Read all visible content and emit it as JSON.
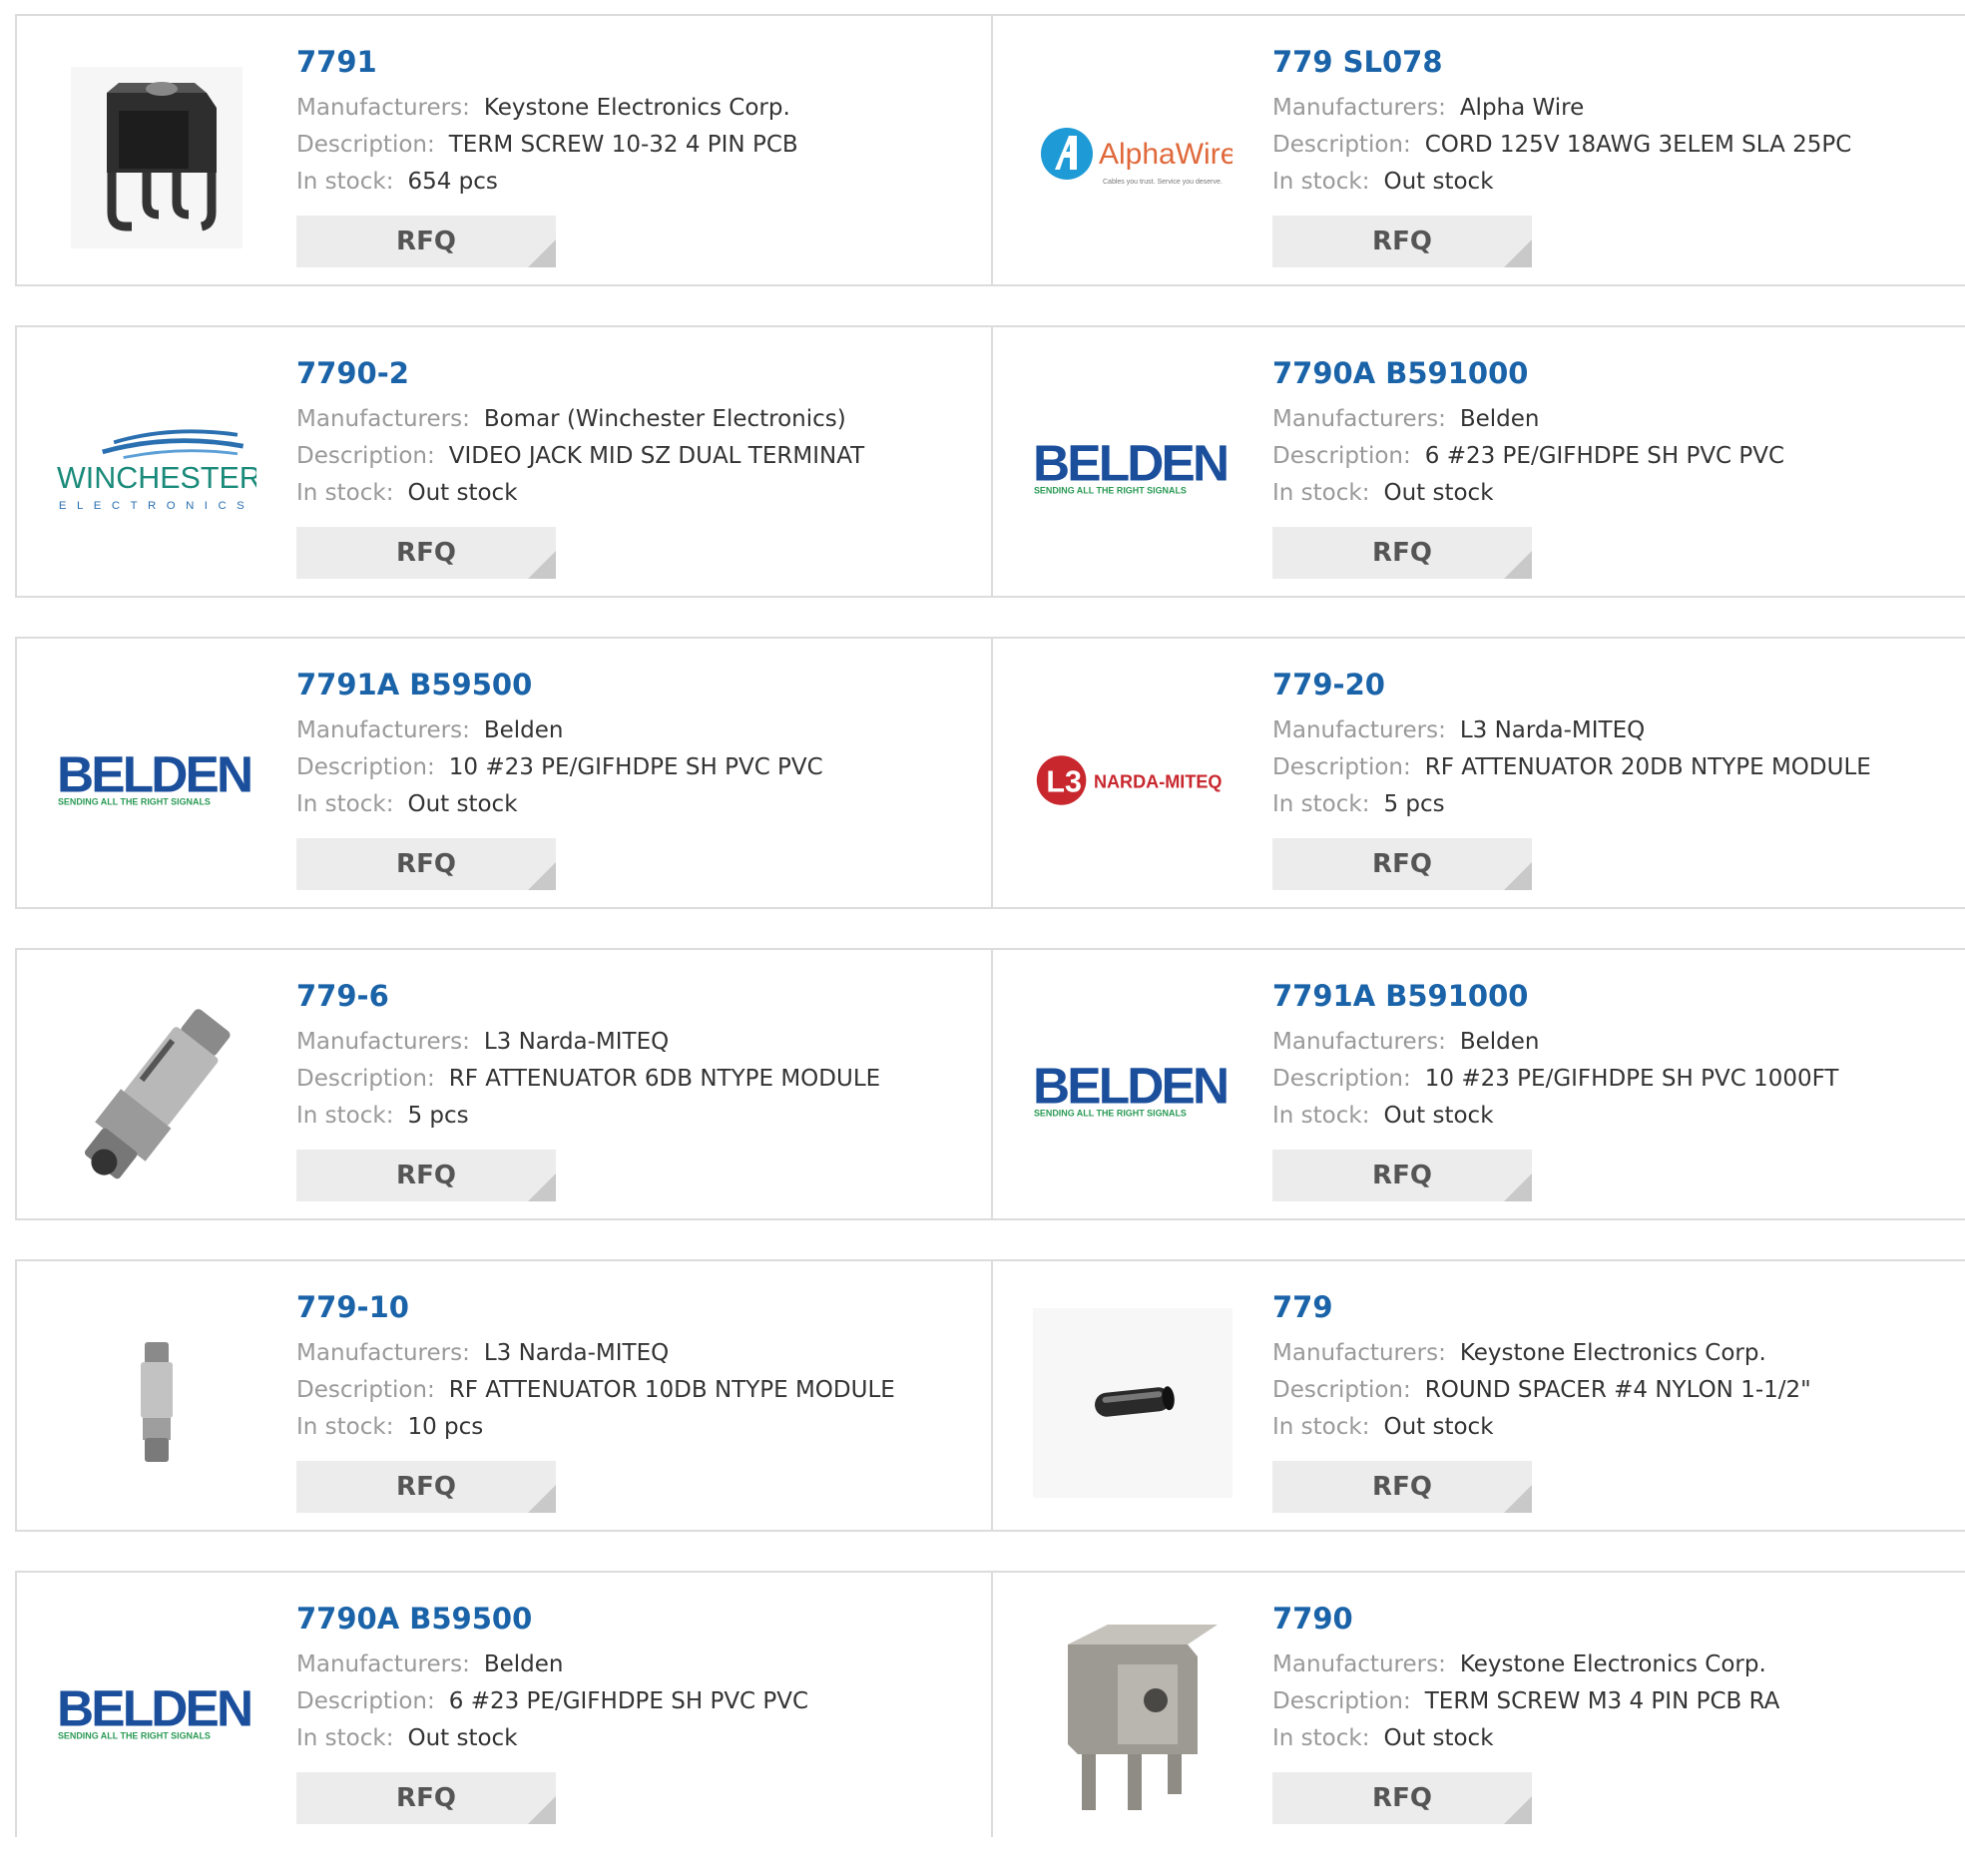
{
  "labels": {
    "manufacturers": "Manufacturers:",
    "description": "Description:",
    "in_stock": "In stock:",
    "rfq": "RFQ"
  },
  "colors": {
    "link_blue": "#1a63a8",
    "label_gray": "#999999",
    "value_dark": "#333333",
    "rfq_bg": "#ececec",
    "border": "#dcdcdc"
  },
  "logos": {
    "alphawire_name": "AlphaWire",
    "alphawire_tag": "Cables you trust. Service you deserve.",
    "winchester_name": "WINCHESTER",
    "winchester_sub": "ELECTRONICS",
    "belden_name": "BELDEN",
    "belden_tag": "SENDING ALL THE RIGHT SIGNALS",
    "l3_mark": "L3",
    "l3_name": "NARDA-MITEQ"
  },
  "products": [
    {
      "part": "7791",
      "manufacturer": "Keystone Electronics Corp.",
      "description": "TERM SCREW 10-32 4 PIN PCB",
      "stock": "654 pcs",
      "image": "terminal-photo"
    },
    {
      "part": "779 SL078",
      "manufacturer": "Alpha Wire",
      "description": "CORD 125V 18AWG 3ELEM SLA 25PC",
      "stock": "Out stock",
      "image": "alphawire-logo"
    },
    {
      "part": "7790-2",
      "manufacturer": "Bomar (Winchester Electronics)",
      "description": "VIDEO JACK MID SZ DUAL TERMINAT",
      "stock": "Out stock",
      "image": "winchester-logo"
    },
    {
      "part": "7790A B591000",
      "manufacturer": "Belden",
      "description": "6 #23 PE/GIFHDPE SH PVC PVC",
      "stock": "Out stock",
      "image": "belden-logo"
    },
    {
      "part": "7791A B59500",
      "manufacturer": "Belden",
      "description": "10 #23 PE/GIFHDPE SH PVC PVC",
      "stock": "Out stock",
      "image": "belden-logo"
    },
    {
      "part": "779-20",
      "manufacturer": "L3 Narda-MITEQ",
      "description": "RF ATTENUATOR 20DB NTYPE MODULE",
      "stock": "5 pcs",
      "image": "l3-logo"
    },
    {
      "part": "779-6",
      "manufacturer": "L3 Narda-MITEQ",
      "description": "RF ATTENUATOR 6DB NTYPE MODULE",
      "stock": "5 pcs",
      "image": "attenuator-photo"
    },
    {
      "part": "7791A B591000",
      "manufacturer": "Belden",
      "description": "10 #23 PE/GIFHDPE SH PVC 1000FT",
      "stock": "Out stock",
      "image": "belden-logo"
    },
    {
      "part": "779-10",
      "manufacturer": "L3 Narda-MITEQ",
      "description": "RF ATTENUATOR 10DB NTYPE MODULE",
      "stock": "10 pcs",
      "image": "small-attenuator-photo"
    },
    {
      "part": "779",
      "manufacturer": "Keystone Electronics Corp.",
      "description": "ROUND SPACER #4 NYLON 1-1/2\"",
      "stock": "Out stock",
      "image": "spacer-photo"
    },
    {
      "part": "7790A B59500",
      "manufacturer": "Belden",
      "description": "6 #23 PE/GIFHDPE SH PVC PVC",
      "stock": "Out stock",
      "image": "belden-logo"
    },
    {
      "part": "7790",
      "manufacturer": "Keystone Electronics Corp.",
      "description": "TERM SCREW M3 4 PIN PCB RA",
      "stock": "Out stock",
      "image": "bracket-photo"
    }
  ]
}
